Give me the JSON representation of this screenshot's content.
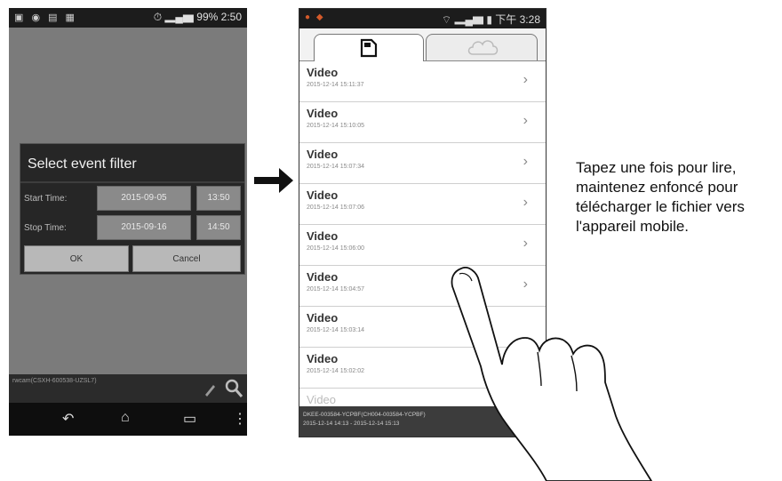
{
  "phone1": {
    "status_time": "2:50",
    "status_battery": "99%",
    "dialog": {
      "title": "Select event filter",
      "start_label": "Start Time:",
      "start_date": "2015-09-05",
      "start_time": "13:50",
      "stop_label": "Stop Time:",
      "stop_date": "2015-09-16",
      "stop_time": "14:50",
      "ok_label": "OK",
      "cancel_label": "Cancel"
    },
    "footer_text": "rwcam(CSXH-600538-UZSL7)"
  },
  "phone2": {
    "status_time": "下午 3:28",
    "items": [
      {
        "title": "Video",
        "date": "2015-12-14 15:11:37"
      },
      {
        "title": "Video",
        "date": "2015-12-14 15:10:05"
      },
      {
        "title": "Video",
        "date": "2015-12-14 15:07:34"
      },
      {
        "title": "Video",
        "date": "2015-12-14 15:07:06"
      },
      {
        "title": "Video",
        "date": "2015-12-14 15:06:00"
      },
      {
        "title": "Video",
        "date": "2015-12-14 15:04:57"
      },
      {
        "title": "Video",
        "date": "2015-12-14 15:03:14"
      },
      {
        "title": "Video",
        "date": "2015-12-14 15:02:02"
      },
      {
        "title": "Video",
        "date": ""
      }
    ],
    "footer_line1": "DKEE-003584-YCPBF(CH004-003584-YCPBF)",
    "footer_line2": "2015-12-14 14:13 - 2015-12-14 15:13"
  },
  "instruction": "Tapez une fois pour lire, maintenez enfoncé pour télécharger le fichier vers l'appareil mobile."
}
